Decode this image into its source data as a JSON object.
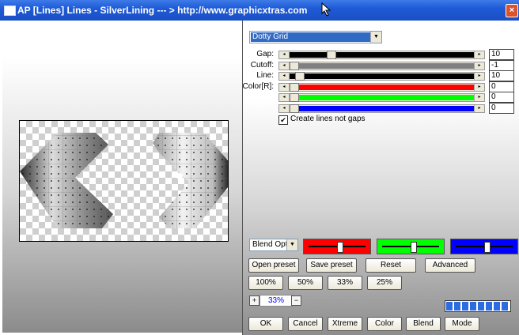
{
  "window": {
    "title": "AP [Lines]  Lines - SilverLining     --- > http://www.graphicxtras.com",
    "close_glyph": "×"
  },
  "preset_select": {
    "value": "Dotty Grid"
  },
  "sliders": [
    {
      "label": "Gap:",
      "value": "10",
      "position": 0.2,
      "color": "#000000"
    },
    {
      "label": "Cutoff:",
      "value": "-1",
      "position": 0.0,
      "color": "#808080"
    },
    {
      "label": "Line:",
      "value": "10",
      "position": 0.03,
      "color": "#000000"
    },
    {
      "label": "Color[R]:",
      "value": "0",
      "position": 0.0,
      "color": "#ff0000"
    },
    {
      "label": "",
      "value": "0",
      "position": 0.0,
      "color": "#00ff00"
    },
    {
      "label": "",
      "value": "0",
      "position": 0.0,
      "color": "#0000ff"
    }
  ],
  "create_gaps": {
    "label": "Create lines not gaps",
    "checked": true,
    "check_glyph": "✔"
  },
  "blend_select": {
    "value": "Blend Opti"
  },
  "blend_bars": [
    {
      "color": "#ff0000",
      "position": 0.55
    },
    {
      "color": "#00ff00",
      "position": 0.55
    },
    {
      "color": "#0000ff",
      "position": 0.55
    }
  ],
  "buttons": {
    "open_preset": "Open preset",
    "save_preset": "Save preset",
    "reset": "Reset",
    "advanced": "Advanced",
    "zoom_100": "100%",
    "zoom_50": "50%",
    "zoom_33": "33%",
    "zoom_25": "25%",
    "ok": "OK",
    "cancel": "Cancel",
    "xtreme": "Xtreme",
    "color": "Color",
    "blend": "Blend",
    "mode": "Mode"
  },
  "zoom": {
    "plus": "+",
    "value": "33%",
    "minus": "−"
  },
  "progress": {
    "segments_filled": 8,
    "segments_total": 8
  },
  "icons": {
    "arrow_left": "◂",
    "arrow_right": "▸",
    "dropdown": "▼"
  }
}
